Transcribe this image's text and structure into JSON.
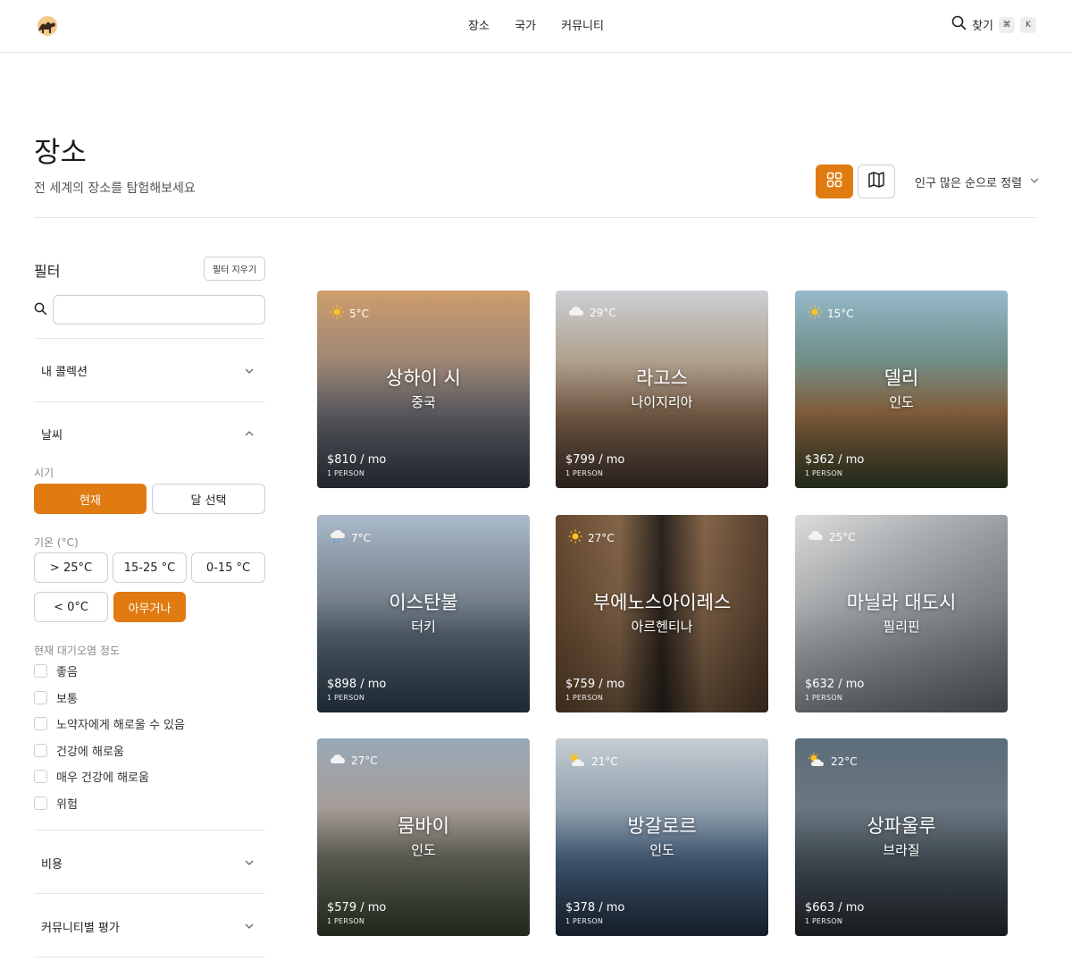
{
  "nav": {
    "items": [
      "장소",
      "국가",
      "커뮤니티"
    ]
  },
  "header_search": {
    "label": "찾기",
    "key1": "⌘",
    "key2": "K"
  },
  "page": {
    "title": "장소",
    "subtitle": "전 세계의 장소를 탐험해보세요"
  },
  "sort": {
    "label": "인구 많은 순으로 정렬"
  },
  "colors": {
    "accent": "#e07b12"
  },
  "filters": {
    "title": "필터",
    "clear_label": "필터 지우기",
    "search_value": "",
    "sections": {
      "collections": "내 콜렉션",
      "weather": "날씨",
      "cost": "비용",
      "community": "커뮤니티별 평가"
    },
    "period_label": "시기",
    "period_options": [
      "현재",
      "달 선택"
    ],
    "temp_label": "기온 (°C)",
    "temp_options": [
      "> 25°C",
      "15-25 °C",
      "0-15 °C",
      "< 0°C",
      "아무거나"
    ],
    "air_label": "현재 대기오염 정도",
    "air_options": [
      "좋음",
      "보통",
      "노약자에게 해로울 수 있음",
      "건강에 해로움",
      "매우 건강에 해로움",
      "위험"
    ]
  },
  "cards": [
    {
      "city": "상하이 시",
      "country": "중국",
      "temp": "5°C",
      "weather_icon": "sun-icon",
      "price": "$810 / mo",
      "person": "1 PERSON"
    },
    {
      "city": "라고스",
      "country": "나이지리아",
      "temp": "29°C",
      "weather_icon": "cloud-icon",
      "price": "$799 / mo",
      "person": "1 PERSON"
    },
    {
      "city": "델리",
      "country": "인도",
      "temp": "15°C",
      "weather_icon": "sun-icon",
      "price": "$362 / mo",
      "person": "1 PERSON"
    },
    {
      "city": "이스탄불",
      "country": "터키",
      "temp": "7°C",
      "weather_icon": "rain-cloud-icon",
      "price": "$898 / mo",
      "person": "1 PERSON"
    },
    {
      "city": "부에노스아이레스",
      "country": "아르헨티나",
      "temp": "27°C",
      "weather_icon": "sun-icon",
      "price": "$759 / mo",
      "person": "1 PERSON"
    },
    {
      "city": "마닐라 대도시",
      "country": "필리핀",
      "temp": "25°C",
      "weather_icon": "cloud-icon",
      "price": "$632 / mo",
      "person": "1 PERSON"
    },
    {
      "city": "뭄바이",
      "country": "인도",
      "temp": "27°C",
      "weather_icon": "cloud-icon",
      "price": "$579 / mo",
      "person": "1 PERSON"
    },
    {
      "city": "방갈로르",
      "country": "인도",
      "temp": "21°C",
      "weather_icon": "partly-cloudy-icon",
      "price": "$378 / mo",
      "person": "1 PERSON"
    },
    {
      "city": "상파울루",
      "country": "브라질",
      "temp": "22°C",
      "weather_icon": "partly-cloudy-icon",
      "price": "$663 / mo",
      "person": "1 PERSON"
    }
  ]
}
